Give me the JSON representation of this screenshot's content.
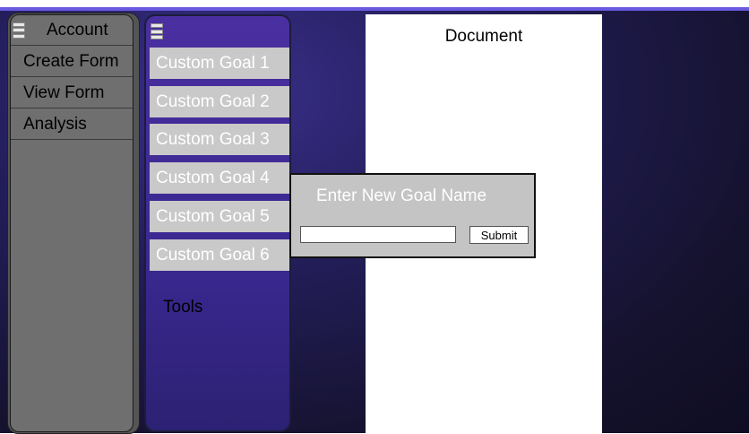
{
  "account_panel": {
    "header_label": "Account",
    "items": [
      {
        "label": "Create Form"
      },
      {
        "label": "View Form"
      },
      {
        "label": "Analysis"
      }
    ]
  },
  "goals_panel": {
    "goals": [
      {
        "label": "Custom Goal 1"
      },
      {
        "label": "Custom Goal 2"
      },
      {
        "label": "Custom Goal 3"
      },
      {
        "label": "Custom Goal 4"
      },
      {
        "label": "Custom Goal 5"
      },
      {
        "label": "Custom Goal 6"
      }
    ],
    "tools_label": "Tools"
  },
  "document": {
    "title": "Document"
  },
  "new_goal_dialog": {
    "title": "Enter New Goal Name",
    "input_value": "",
    "submit_label": "Submit"
  },
  "icons": {
    "menu": "hamburger-menu-icon"
  },
  "colors": {
    "panel_purple": "#3a2890",
    "goal_item_bg": "#c9c9c9",
    "account_panel_bg": "#6f6f6f",
    "background_dark": "#15122e"
  }
}
